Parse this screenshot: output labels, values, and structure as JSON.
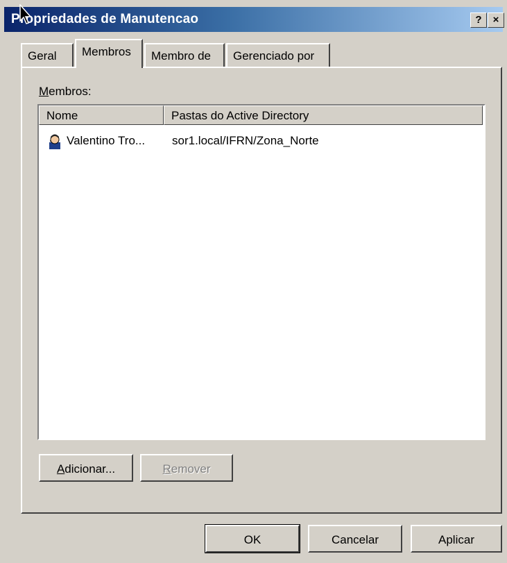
{
  "window": {
    "title": "Propriedades de Manutencao",
    "help": "?",
    "close": "×"
  },
  "tabs": [
    "Geral",
    "Membros",
    "Membro de",
    "Gerenciado por"
  ],
  "members": {
    "label_accel": "M",
    "label_rest": "embros:",
    "columns": [
      "Nome",
      "Pastas do Active Directory"
    ],
    "rows": [
      {
        "name": "Valentino Tro...",
        "folder": "sor1.local/IFRN/Zona_Norte",
        "icon": "user-icon"
      }
    ]
  },
  "buttons": {
    "add_accel": "A",
    "add_rest": "dicionar...",
    "remove_accel": "R",
    "remove_rest": "emover",
    "ok": "OK",
    "cancel": "Cancelar",
    "apply": "Aplicar"
  }
}
